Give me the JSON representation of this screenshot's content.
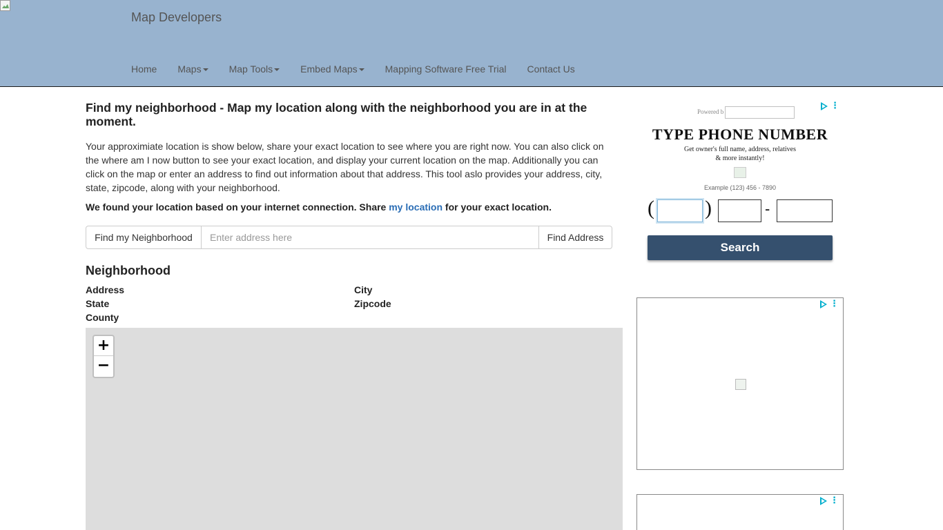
{
  "site": {
    "brand": "Map Developers"
  },
  "nav": {
    "items": [
      {
        "label": "Home",
        "dropdown": false
      },
      {
        "label": "Maps",
        "dropdown": true
      },
      {
        "label": "Map Tools",
        "dropdown": true
      },
      {
        "label": "Embed Maps",
        "dropdown": true
      },
      {
        "label": "Mapping Software Free Trial",
        "dropdown": false
      },
      {
        "label": "Contact Us",
        "dropdown": false
      }
    ]
  },
  "main": {
    "title": "Find my neighborhood - Map my location along with the neighborhood you are in at the moment.",
    "intro": "Your approximiate location is show below, share your exact location to see where you are right now. You can also click on the where am I now button to see your exact location, and display your current location on the map. Additionally you can click on the map or enter an address to find out information about that address. This tool aslo provides your address, city, state, zipcode, along with your neighborhood.",
    "found_prefix": "We found your location based on your internet connection. Share ",
    "found_link": "my location",
    "found_suffix": " for your exact location.",
    "find_neighborhood_button": "Find my Neighborhood",
    "address_placeholder": "Enter address here",
    "address_value": "",
    "find_address_button": "Find Address",
    "neighborhood_heading": "Neighborhood",
    "labels": {
      "address": "Address",
      "city": "City",
      "state": "State",
      "zipcode": "Zipcode",
      "county": "County"
    },
    "map": {
      "zoom_in": "+",
      "zoom_out": "−",
      "background": "#dddddd"
    }
  },
  "ads": {
    "ad1": {
      "powered": "Powered b",
      "title": "TYPE PHONE NUMBER",
      "subtitle_line1": "Get owner's full name, address, relatives",
      "subtitle_line2": "& more instantly!",
      "example": "Example (123) 456 - 7890",
      "open_paren": "(",
      "close_paren": ")",
      "dash": "-",
      "search_button": "Search"
    },
    "choices_dots": "⋮"
  },
  "colors": {
    "header_bg": "#98b3cf",
    "link": "#2a6db5",
    "ad_button": "#35506e",
    "ad_choices": "#00aecd"
  }
}
